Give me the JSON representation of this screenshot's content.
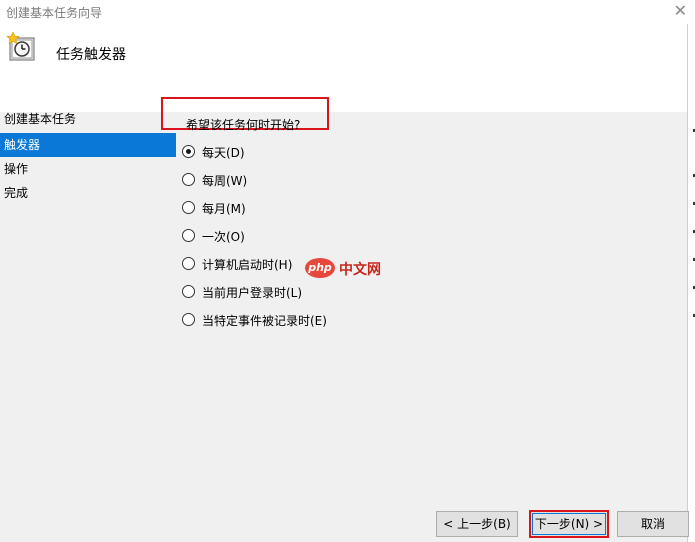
{
  "window": {
    "title": "创建基本任务向导",
    "close_glyph": "✕"
  },
  "header": {
    "title": "任务触发器",
    "icon": "task-clock-icon"
  },
  "sidebar": {
    "items": [
      {
        "label": "创建基本任务",
        "active": false
      },
      {
        "label": "触发器",
        "active": true
      },
      {
        "label": "操作",
        "active": false
      },
      {
        "label": "完成",
        "active": false
      }
    ]
  },
  "main": {
    "question": "希望该任务何时开始?",
    "options": [
      {
        "label": "每天(D)",
        "checked": true
      },
      {
        "label": "每周(W)",
        "checked": false
      },
      {
        "label": "每月(M)",
        "checked": false
      },
      {
        "label": "一次(O)",
        "checked": false
      },
      {
        "label": "计算机启动时(H)",
        "checked": false
      },
      {
        "label": "当前用户登录时(L)",
        "checked": false
      },
      {
        "label": "当特定事件被记录时(E)",
        "checked": false
      }
    ]
  },
  "watermark": {
    "logo_text": "php",
    "text": "中文网"
  },
  "buttons": {
    "back": "< 上一步(B)",
    "next": "下一步(N) >",
    "cancel": "取消"
  },
  "colors": {
    "selection": "#0a78d7",
    "highlight_box": "#d9141b"
  }
}
